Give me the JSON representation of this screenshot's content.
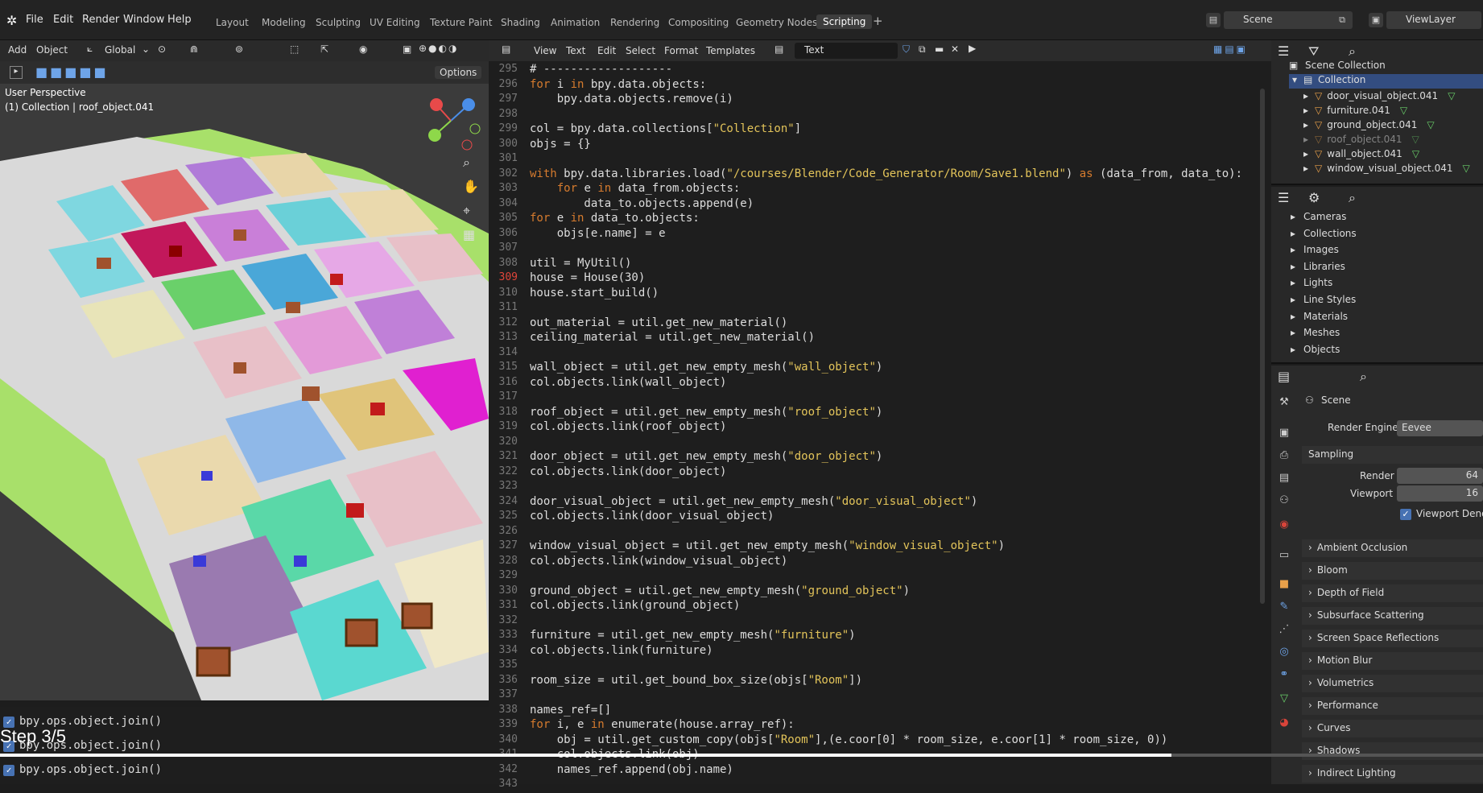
{
  "topbar": {
    "menus": [
      "File",
      "Edit",
      "Render",
      "Window",
      "Help"
    ],
    "workspaces": [
      "Layout",
      "Modeling",
      "Sculpting",
      "UV Editing",
      "Texture Paint",
      "Shading",
      "Animation",
      "Rendering",
      "Compositing",
      "Geometry Nodes",
      "Scripting"
    ],
    "active_workspace": "Scripting",
    "add_tab": "+",
    "scene": "Scene",
    "view_layer": "ViewLayer"
  },
  "viewport": {
    "menu": [
      "Add",
      "Object"
    ],
    "orientation": "Global",
    "options": "Options",
    "view_name": "User Perspective",
    "active": "(1) Collection | roof_object.041"
  },
  "editor": {
    "menu": [
      "View",
      "Text",
      "Edit",
      "Select",
      "Format",
      "Templates"
    ],
    "text_name": "Text",
    "lines": [
      {
        "n": "295",
        "t": "# -------------------"
      },
      {
        "n": "296",
        "t": "for i in bpy.data.objects:"
      },
      {
        "n": "297",
        "t": "    bpy.data.objects.remove(i)"
      },
      {
        "n": "298",
        "t": ""
      },
      {
        "n": "299",
        "t": "col = bpy.data.collections[\"Collection\"]"
      },
      {
        "n": "300",
        "t": "objs = {}"
      },
      {
        "n": "301",
        "t": ""
      },
      {
        "n": "302",
        "t": "with bpy.data.libraries.load(\"/courses/Blender/Code_Generator/Room/Save1.blend\") as (data_from, data_to):"
      },
      {
        "n": "303",
        "t": "    for e in data_from.objects:"
      },
      {
        "n": "304",
        "t": "        data_to.objects.append(e)"
      },
      {
        "n": "305",
        "t": "for e in data_to.objects:"
      },
      {
        "n": "306",
        "t": "    objs[e.name] = e"
      },
      {
        "n": "307",
        "t": ""
      },
      {
        "n": "308",
        "t": "util = MyUtil()"
      },
      {
        "n": "309",
        "t": "house = House(30)"
      },
      {
        "n": "310",
        "t": "house.start_build()"
      },
      {
        "n": "311",
        "t": ""
      },
      {
        "n": "312",
        "t": "out_material = util.get_new_material()"
      },
      {
        "n": "313",
        "t": "ceiling_material = util.get_new_material()"
      },
      {
        "n": "314",
        "t": ""
      },
      {
        "n": "315",
        "t": "wall_object = util.get_new_empty_mesh(\"wall_object\")"
      },
      {
        "n": "316",
        "t": "col.objects.link(wall_object)"
      },
      {
        "n": "317",
        "t": ""
      },
      {
        "n": "318",
        "t": "roof_object = util.get_new_empty_mesh(\"roof_object\")"
      },
      {
        "n": "319",
        "t": "col.objects.link(roof_object)"
      },
      {
        "n": "320",
        "t": ""
      },
      {
        "n": "321",
        "t": "door_object = util.get_new_empty_mesh(\"door_object\")"
      },
      {
        "n": "322",
        "t": "col.objects.link(door_object)"
      },
      {
        "n": "323",
        "t": ""
      },
      {
        "n": "324",
        "t": "door_visual_object = util.get_new_empty_mesh(\"door_visual_object\")"
      },
      {
        "n": "325",
        "t": "col.objects.link(door_visual_object)"
      },
      {
        "n": "326",
        "t": ""
      },
      {
        "n": "327",
        "t": "window_visual_object = util.get_new_empty_mesh(\"window_visual_object\")"
      },
      {
        "n": "328",
        "t": "col.objects.link(window_visual_object)"
      },
      {
        "n": "329",
        "t": ""
      },
      {
        "n": "330",
        "t": "ground_object = util.get_new_empty_mesh(\"ground_object\")"
      },
      {
        "n": "331",
        "t": "col.objects.link(ground_object)"
      },
      {
        "n": "332",
        "t": ""
      },
      {
        "n": "333",
        "t": "furniture = util.get_new_empty_mesh(\"furniture\")"
      },
      {
        "n": "334",
        "t": "col.objects.link(furniture)"
      },
      {
        "n": "335",
        "t": ""
      },
      {
        "n": "336",
        "t": "room_size = util.get_bound_box_size(objs[\"Room\"])"
      },
      {
        "n": "337",
        "t": ""
      },
      {
        "n": "338",
        "t": "names_ref=[]"
      },
      {
        "n": "339",
        "t": "for i, e in enumerate(house.array_ref):"
      },
      {
        "n": "340",
        "t": "    obj = util.get_custom_copy(objs[\"Room\"],(e.coor[0] * room_size, e.coor[1] * room_size, 0))"
      },
      {
        "n": "341",
        "t": "    col.objects.link(obj)"
      },
      {
        "n": "342",
        "t": "    names_ref.append(obj.name)"
      },
      {
        "n": "343",
        "t": ""
      }
    ]
  },
  "outliner": {
    "root": "Scene Collection",
    "collection": "Collection",
    "items": [
      "door_visual_object.041",
      "furniture.041",
      "ground_object.041",
      "roof_object.041",
      "wall_object.041",
      "window_visual_object.041"
    ]
  },
  "datablocks": [
    "Cameras",
    "Collections",
    "Images",
    "Libraries",
    "Lights",
    "Line Styles",
    "Materials",
    "Meshes",
    "Objects"
  ],
  "properties": {
    "scene": "Scene",
    "render_engine_label": "Render Engine",
    "render_engine": "Eevee",
    "sampling": "Sampling",
    "render_label": "Render",
    "render_value": "64",
    "viewport_label": "Viewport",
    "viewport_value": "16",
    "denoise": "Viewport Denoisin",
    "panels": [
      "Ambient Occlusion",
      "Bloom",
      "Depth of Field",
      "Subsurface Scattering",
      "Screen Space Reflections",
      "Motion Blur",
      "Volumetrics",
      "Performance",
      "Curves",
      "Shadows",
      "Indirect Lighting"
    ]
  },
  "console": {
    "lines": [
      "bpy.ops.object.join()",
      "bpy.ops.object.join()",
      "bpy.ops.object.join()"
    ]
  },
  "overlay": {
    "step": "Step 3/5",
    "progress": 0.79
  },
  "colors": {
    "keyword": "#d67b2e",
    "string": "#e3c45a",
    "accent": "#4772b3",
    "ground": "#a8e06a"
  }
}
